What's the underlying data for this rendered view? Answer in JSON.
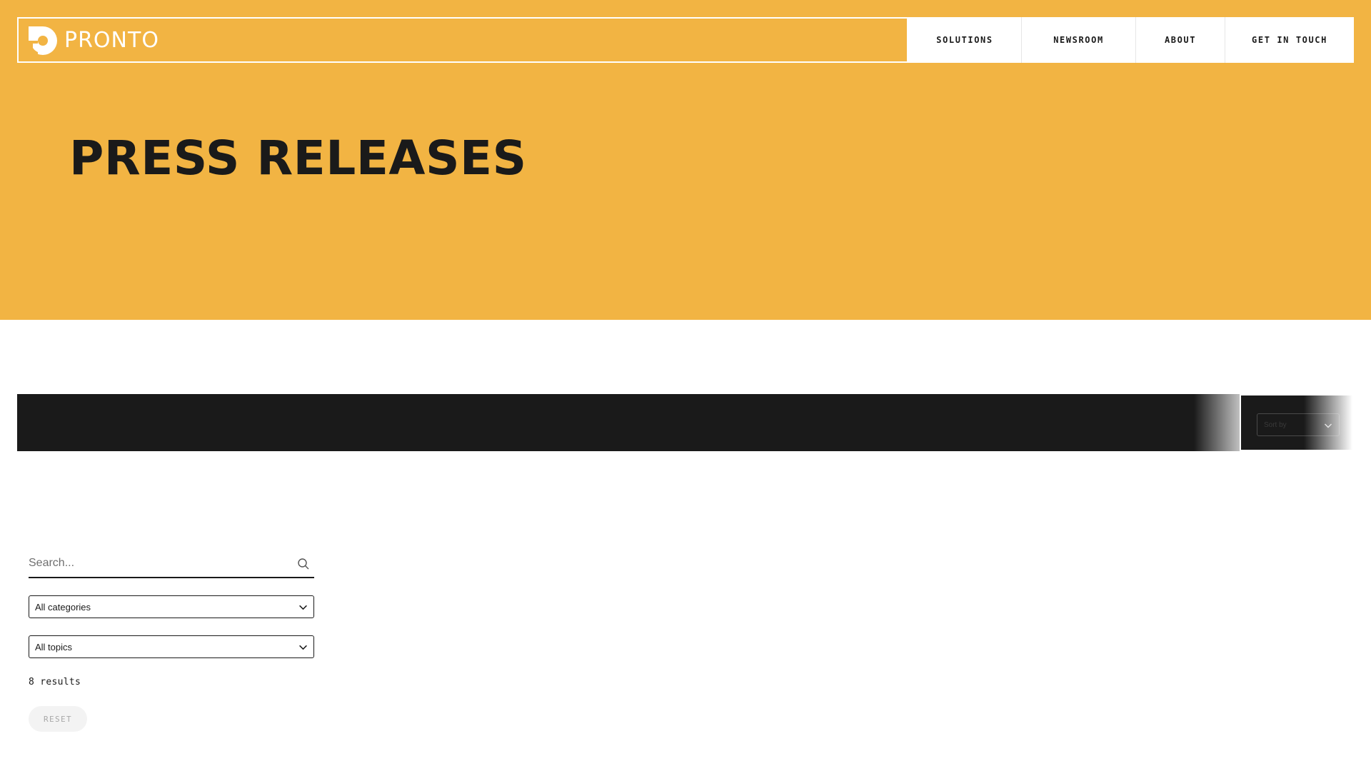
{
  "brand": {
    "name": "PRONTO",
    "colors": {
      "accent": "#f2b443",
      "dark": "#1a1a1a",
      "white": "#ffffff"
    }
  },
  "nav": {
    "items": [
      {
        "label": "SOLUTIONS"
      },
      {
        "label": "NEWSROOM"
      },
      {
        "label": "ABOUT"
      },
      {
        "label": "GET IN TOUCH"
      }
    ]
  },
  "hero": {
    "title": "PRESS RELEASES"
  },
  "toolbar": {
    "sort_label": "Sort by",
    "sort_icon": "chevron-down-icon"
  },
  "filters": {
    "search": {
      "placeholder": "Search...",
      "value": "",
      "icon": "search-icon"
    },
    "category": {
      "selected": "All categories"
    },
    "topic": {
      "selected": "All topics"
    },
    "results_text": "8 results",
    "reset_label": "RESET"
  }
}
